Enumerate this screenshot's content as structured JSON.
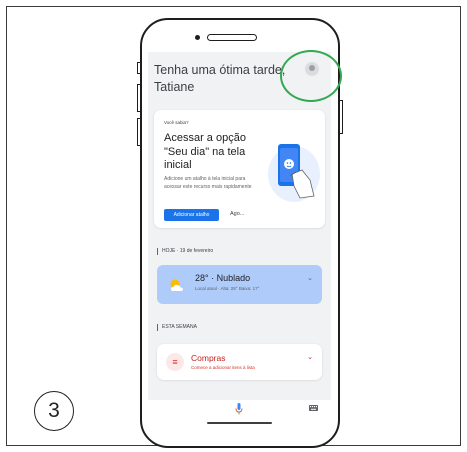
{
  "step_number": "3",
  "greeting": "Tenha uma ótima tarde, Tatiane",
  "tip_card": {
    "small_label": "Você sabia?",
    "title": "Acessar a opção \"Seu dia\" na tela inicial",
    "description": "Adicione um atalho à tela inicial para acessar este recurso mais rapidamente",
    "add_button": "Adicionar atalho",
    "later_button": "Ago..."
  },
  "today_section": {
    "label": "HOJE · 19 de fevereiro"
  },
  "weather": {
    "main": "28° · Nublado",
    "sub": "Local atual · Alta: 28° Baixa: 17°",
    "icon": "partly-cloudy-icon"
  },
  "week_section": {
    "label": "ESTA SEMANA"
  },
  "shopping_list": {
    "title": "Compras",
    "subtitle": "Comece a adicionar itens à lista",
    "icon": "list-icon"
  },
  "colors": {
    "accent_blue": "#1a73e8",
    "weather_card": "#aecbfa",
    "list_red": "#d93025",
    "highlight_green": "#34a853"
  }
}
